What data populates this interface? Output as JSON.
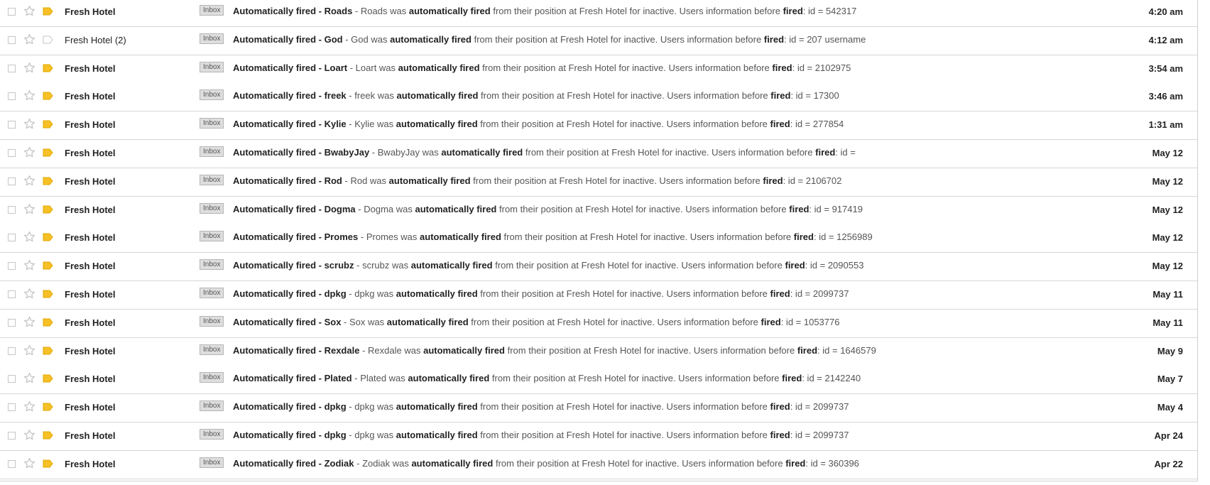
{
  "emails": [
    {
      "sender": "Fresh Hotel",
      "count": "",
      "label": "Inbox",
      "subject": "Automatically fired - Roads",
      "snippet_lead": "Roads was",
      "snippet_tail": "from their position at Fresh Hotel for inactive. Users information before",
      "snippet_end": ": id = 542317",
      "date": "4:20 am",
      "unread": true,
      "labeled": true
    },
    {
      "sender": "Fresh Hotel",
      "count": "(2)",
      "label": "Inbox",
      "subject": "Automatically fired - God",
      "snippet_lead": "God was",
      "snippet_tail": "from their position at Fresh Hotel for inactive. Users information before",
      "snippet_end": ": id = 207 username",
      "date": "4:12 am",
      "unread": false,
      "labeled": false
    },
    {
      "sender": "Fresh Hotel",
      "count": "",
      "label": "Inbox",
      "subject": "Automatically fired - Loart",
      "snippet_lead": "Loart was",
      "snippet_tail": "from their position at Fresh Hotel for inactive. Users information before",
      "snippet_end": ": id = 2102975",
      "date": "3:54 am",
      "unread": true,
      "labeled": true
    },
    {
      "sender": "Fresh Hotel",
      "count": "",
      "label": "Inbox",
      "subject": "Automatically fired - freek",
      "snippet_lead": "freek was",
      "snippet_tail": "from their position at Fresh Hotel for inactive. Users information before",
      "snippet_end": ": id = 17300",
      "date": "3:46 am",
      "unread": true,
      "labeled": true
    },
    {
      "sender": "Fresh Hotel",
      "count": "",
      "label": "Inbox",
      "subject": "Automatically fired - Kylie",
      "snippet_lead": "Kylie was",
      "snippet_tail": "from their position at Fresh Hotel for inactive. Users information before",
      "snippet_end": ": id = 277854",
      "date": "1:31 am",
      "unread": true,
      "labeled": true
    },
    {
      "sender": "Fresh Hotel",
      "count": "",
      "label": "Inbox",
      "subject": "Automatically fired - BwabyJay",
      "snippet_lead": "BwabyJay was",
      "snippet_tail": "from their position at Fresh Hotel for inactive. Users information before",
      "snippet_end": ": id =",
      "date": "May 12",
      "unread": true,
      "labeled": true
    },
    {
      "sender": "Fresh Hotel",
      "count": "",
      "label": "Inbox",
      "subject": "Automatically fired - Rod",
      "snippet_lead": "Rod was",
      "snippet_tail": "from their position at Fresh Hotel for inactive. Users information before",
      "snippet_end": ": id = 2106702",
      "date": "May 12",
      "unread": true,
      "labeled": true
    },
    {
      "sender": "Fresh Hotel",
      "count": "",
      "label": "Inbox",
      "subject": "Automatically fired - Dogma",
      "snippet_lead": "Dogma was",
      "snippet_tail": "from their position at Fresh Hotel for inactive. Users information before",
      "snippet_end": ": id = 917419",
      "date": "May 12",
      "unread": true,
      "labeled": true
    },
    {
      "sender": "Fresh Hotel",
      "count": "",
      "label": "Inbox",
      "subject": "Automatically fired - Promes",
      "snippet_lead": "Promes was",
      "snippet_tail": "from their position at Fresh Hotel for inactive. Users information before",
      "snippet_end": ": id = 1256989",
      "date": "May 12",
      "unread": true,
      "labeled": true
    },
    {
      "sender": "Fresh Hotel",
      "count": "",
      "label": "Inbox",
      "subject": "Automatically fired - scrubz",
      "snippet_lead": "scrubz was",
      "snippet_tail": "from their position at Fresh Hotel for inactive. Users information before",
      "snippet_end": ": id = 2090553",
      "date": "May 12",
      "unread": true,
      "labeled": true
    },
    {
      "sender": "Fresh Hotel",
      "count": "",
      "label": "Inbox",
      "subject": "Automatically fired - dpkg",
      "snippet_lead": "dpkg was",
      "snippet_tail": "from their position at Fresh Hotel for inactive. Users information before",
      "snippet_end": ": id = 2099737",
      "date": "May 11",
      "unread": true,
      "labeled": true
    },
    {
      "sender": "Fresh Hotel",
      "count": "",
      "label": "Inbox",
      "subject": "Automatically fired - Sox",
      "snippet_lead": "Sox was",
      "snippet_tail": "from their position at Fresh Hotel for inactive. Users information before",
      "snippet_end": ": id = 1053776",
      "date": "May 11",
      "unread": true,
      "labeled": true
    },
    {
      "sender": "Fresh Hotel",
      "count": "",
      "label": "Inbox",
      "subject": "Automatically fired - Rexdale",
      "snippet_lead": "Rexdale was",
      "snippet_tail": "from their position at Fresh Hotel for inactive. Users information before",
      "snippet_end": ": id = 1646579",
      "date": "May 9",
      "unread": true,
      "labeled": true
    },
    {
      "sender": "Fresh Hotel",
      "count": "",
      "label": "Inbox",
      "subject": "Automatically fired - Plated",
      "snippet_lead": "Plated was",
      "snippet_tail": "from their position at Fresh Hotel for inactive. Users information before",
      "snippet_end": ": id = 2142240",
      "date": "May 7",
      "unread": true,
      "labeled": true
    },
    {
      "sender": "Fresh Hotel",
      "count": "",
      "label": "Inbox",
      "subject": "Automatically fired - dpkg",
      "snippet_lead": "dpkg was",
      "snippet_tail": "from their position at Fresh Hotel for inactive. Users information before",
      "snippet_end": ": id = 2099737",
      "date": "May 4",
      "unread": true,
      "labeled": true
    },
    {
      "sender": "Fresh Hotel",
      "count": "",
      "label": "Inbox",
      "subject": "Automatically fired - dpkg",
      "snippet_lead": "dpkg was",
      "snippet_tail": "from their position at Fresh Hotel for inactive. Users information before",
      "snippet_end": ": id = 2099737",
      "date": "Apr 24",
      "unread": true,
      "labeled": true
    },
    {
      "sender": "Fresh Hotel",
      "count": "",
      "label": "Inbox",
      "subject": "Automatically fired - Zodiak",
      "snippet_lead": "Zodiak was",
      "snippet_tail": "from their position at Fresh Hotel for inactive. Users information before",
      "snippet_end": ": id = 360396",
      "date": "Apr 22",
      "unread": true,
      "labeled": true
    }
  ],
  "emphasis": {
    "auto": "automatically fired",
    "fired": "fired",
    "separator": "-"
  },
  "colors": {
    "label_important": "#f6c026",
    "star_outline": "#c4c4c4",
    "border": "#d6d6d6"
  },
  "icons": {
    "star": "star-icon",
    "label": "label-tag-icon",
    "checkbox": "checkbox"
  }
}
